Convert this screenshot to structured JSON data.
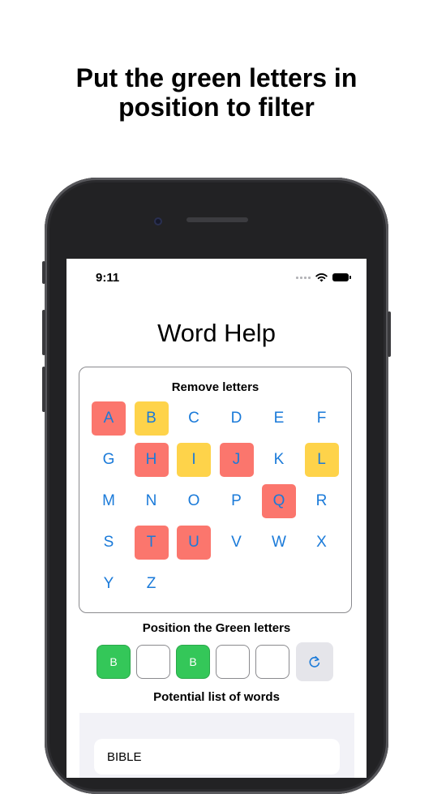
{
  "headline": {
    "line1": "Put the green letters in",
    "line2": "position to filter"
  },
  "status_bar": {
    "time": "9:11",
    "icons": [
      "signal-dots-icon",
      "wifi-icon",
      "battery-icon"
    ]
  },
  "app_title": "Word Help",
  "remove_panel": {
    "title": "Remove letters",
    "letters": [
      {
        "letter": "A",
        "state": "removed"
      },
      {
        "letter": "B",
        "state": "yellow"
      },
      {
        "letter": "C",
        "state": "none"
      },
      {
        "letter": "D",
        "state": "none"
      },
      {
        "letter": "E",
        "state": "none"
      },
      {
        "letter": "F",
        "state": "none"
      },
      {
        "letter": "G",
        "state": "none"
      },
      {
        "letter": "H",
        "state": "removed"
      },
      {
        "letter": "I",
        "state": "yellow"
      },
      {
        "letter": "J",
        "state": "removed"
      },
      {
        "letter": "K",
        "state": "none"
      },
      {
        "letter": "L",
        "state": "yellow"
      },
      {
        "letter": "M",
        "state": "none"
      },
      {
        "letter": "N",
        "state": "none"
      },
      {
        "letter": "O",
        "state": "none"
      },
      {
        "letter": "P",
        "state": "none"
      },
      {
        "letter": "Q",
        "state": "removed"
      },
      {
        "letter": "R",
        "state": "none"
      },
      {
        "letter": "S",
        "state": "none"
      },
      {
        "letter": "T",
        "state": "removed"
      },
      {
        "letter": "U",
        "state": "removed"
      },
      {
        "letter": "V",
        "state": "none"
      },
      {
        "letter": "W",
        "state": "none"
      },
      {
        "letter": "X",
        "state": "none"
      },
      {
        "letter": "Y",
        "state": "none"
      },
      {
        "letter": "Z",
        "state": "none"
      }
    ]
  },
  "position_section": {
    "title": "Position the Green letters",
    "slots": [
      {
        "value": "B",
        "state": "green"
      },
      {
        "value": "",
        "state": "empty"
      },
      {
        "value": "B",
        "state": "green"
      },
      {
        "value": "",
        "state": "empty"
      },
      {
        "value": "",
        "state": "empty"
      }
    ],
    "reset_icon": "refresh-icon"
  },
  "word_section": {
    "title": "Potential list of words",
    "words": [
      "BIBLE"
    ]
  },
  "colors": {
    "removed": "#fb766d",
    "yellow": "#fed34a",
    "green": "#34c759",
    "letter_text": "#1a7ad9"
  }
}
